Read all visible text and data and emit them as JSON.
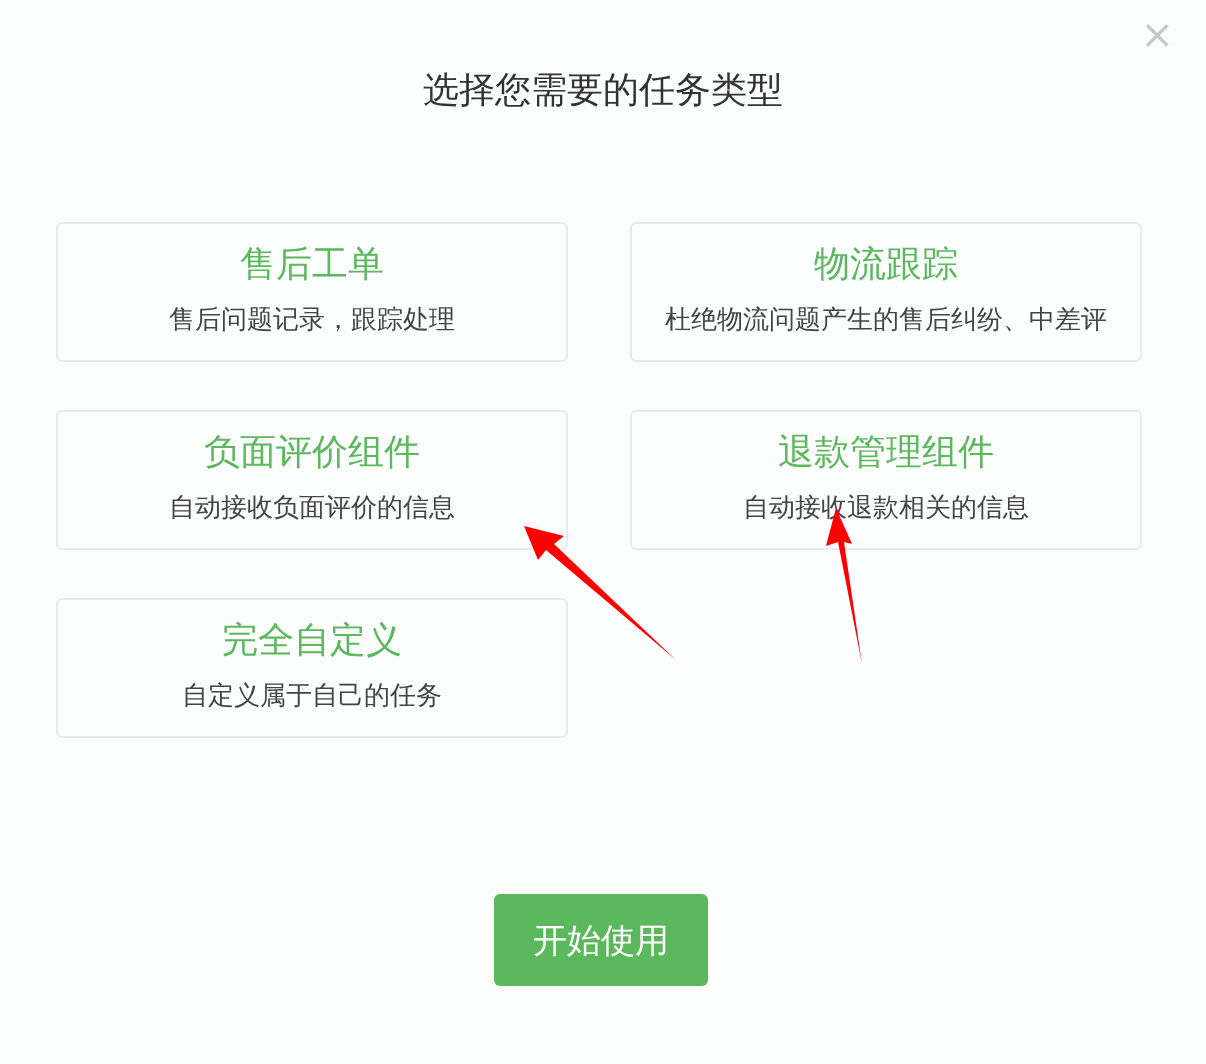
{
  "dialog": {
    "close_icon": "×",
    "title": "选择您需要的任务类型",
    "options": [
      {
        "title": "售后工单",
        "description": "售后问题记录，跟踪处理"
      },
      {
        "title": "物流跟踪",
        "description": "杜绝物流问题产生的售后纠纷、中差评"
      },
      {
        "title": "负面评价组件",
        "description": "自动接收负面评价的信息"
      },
      {
        "title": "退款管理组件",
        "description": "自动接收退款相关的信息"
      },
      {
        "title": "完全自定义",
        "description": "自定义属于自己的任务"
      }
    ],
    "start_button": "开始使用"
  }
}
